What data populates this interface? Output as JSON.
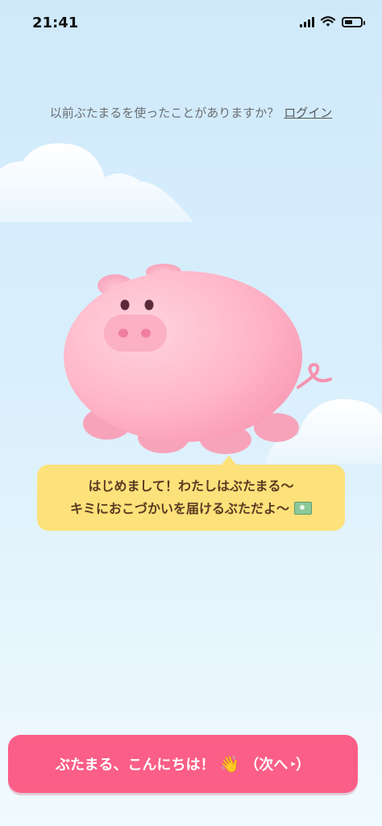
{
  "status_bar": {
    "time": "21:41"
  },
  "header": {
    "question": "以前ぶたまるを使ったことがありますか？",
    "login_link": "ログイン"
  },
  "speech_bubble": {
    "line1": "はじめまして！わたしはぶたまる〜",
    "line2": "キミにおこづかいを届けるぶただよ〜",
    "icon": "money-icon"
  },
  "primary_button": {
    "label": "ぶたまる、こんにちは！",
    "wave_icon": "👋",
    "next_text": "（次へ",
    "arrow_icon": "▸",
    "close_paren": "）"
  },
  "colors": {
    "button": "#fb5e86",
    "bubble": "#fde17a",
    "pig_body": "#ffb6c8",
    "sky": "#cfe9fb"
  }
}
